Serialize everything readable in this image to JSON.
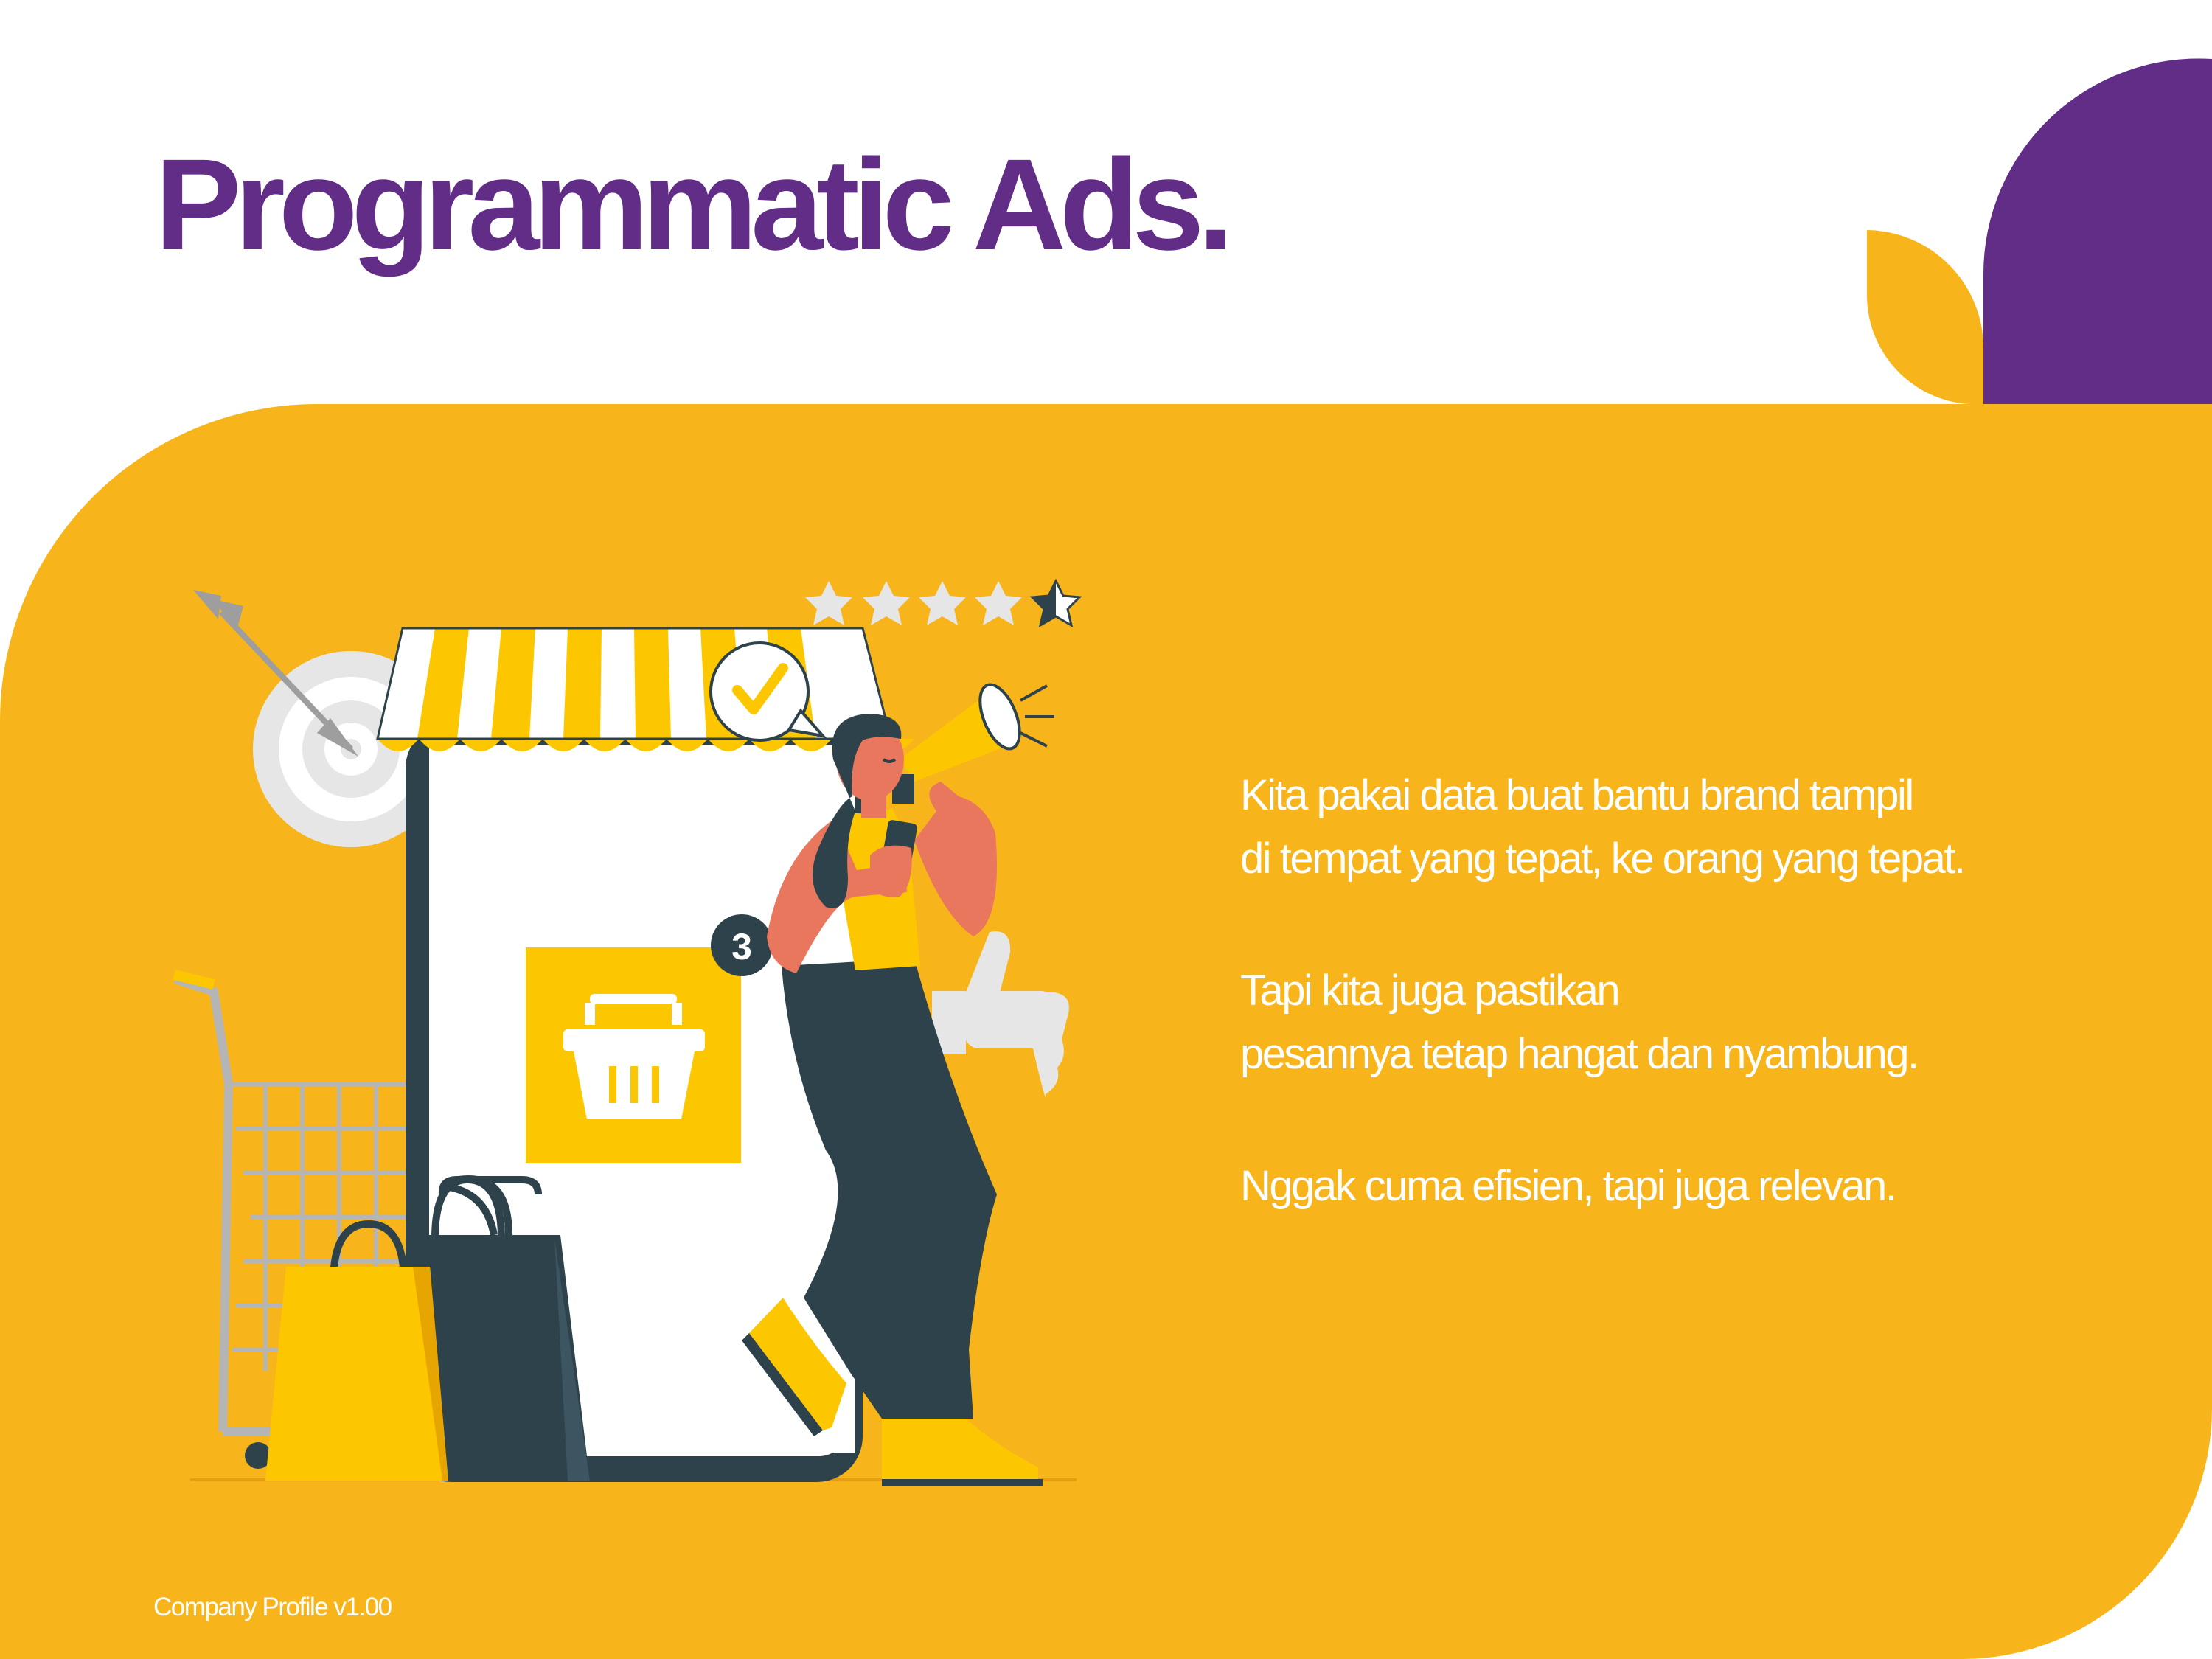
{
  "slide": {
    "title": "Programmatic Ads.",
    "paragraphs": [
      {
        "lines": [
          "Kita pakai data buat bantu brand tampil",
          "di tempat yang tepat, ke orang yang tepat."
        ]
      },
      {
        "lines": [
          "Tapi kita juga pastikan",
          "pesannya tetap hangat dan nyambung."
        ]
      },
      {
        "lines": [
          "Nggak cuma efisien, tapi juga relevan."
        ]
      }
    ],
    "footer": "Company Profile v1.00"
  },
  "illustration": {
    "rating_badge_count": "3",
    "stars_full": 4,
    "stars_half": 1
  },
  "colors": {
    "brand_purple": "#622d87",
    "brand_yellow": "#f7b51b",
    "accent_yellow": "#fdc700",
    "dark_teal": "#2d424b",
    "skin": "#e9775e",
    "light_gray": "#e6e6e6"
  }
}
